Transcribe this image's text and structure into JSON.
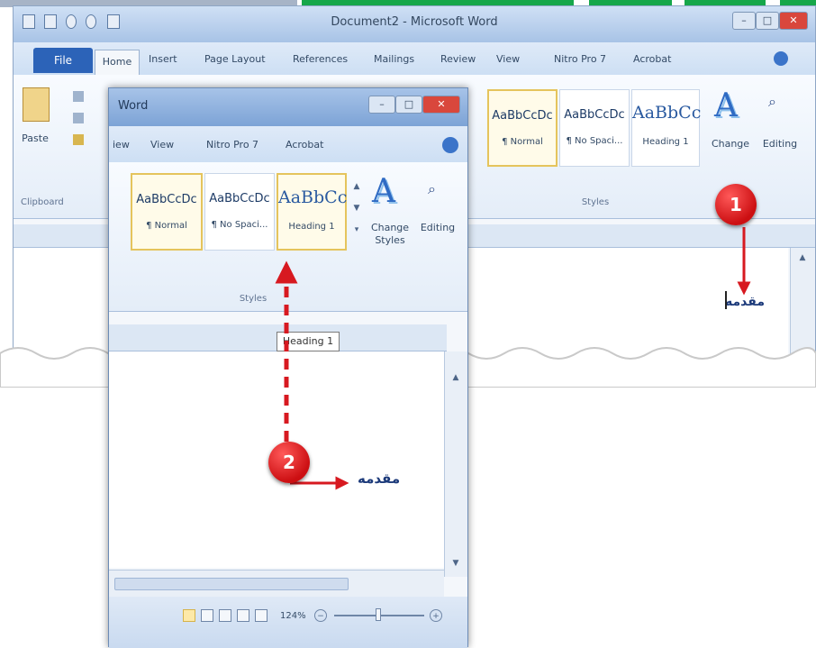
{
  "background_window": {
    "title": "Document2 - Microsoft Word",
    "tabs": [
      {
        "label": "File"
      },
      {
        "label": "Home"
      },
      {
        "label": "Insert"
      },
      {
        "label": "Page Layout"
      },
      {
        "label": "References"
      },
      {
        "label": "Mailings"
      },
      {
        "label": "Review"
      },
      {
        "label": "View"
      },
      {
        "label": "Nitro Pro 7"
      },
      {
        "label": "Acrobat"
      }
    ],
    "clipboard": {
      "paste_label": "Paste",
      "group_label": "Clipboard"
    },
    "styles": [
      {
        "sample": "AaBbCcDc",
        "name": "¶ Normal"
      },
      {
        "sample": "AaBbCcDc",
        "name": "¶ No Spaci..."
      },
      {
        "sample": "AaBbCc",
        "name": "Heading 1"
      }
    ],
    "styles_group_label": "Styles",
    "change_styles_label": "Change",
    "editing_label": "Editing",
    "document_text": "مقدمه"
  },
  "front_window": {
    "title": "Word",
    "tabs": [
      {
        "label": "iew"
      },
      {
        "label": "View"
      },
      {
        "label": "Nitro Pro 7"
      },
      {
        "label": "Acrobat"
      }
    ],
    "styles": [
      {
        "sample": "AaBbCcDc",
        "name": "¶ Normal"
      },
      {
        "sample": "AaBbCcDc",
        "name": "¶ No Spaci..."
      },
      {
        "sample": "AaBbCc",
        "name": "Heading 1"
      }
    ],
    "styles_group_label": "Styles",
    "change_styles_label": "Change Styles",
    "editing_label": "Editing",
    "tooltip": "Heading 1",
    "document_text": "مقدمه",
    "zoom_level": "124%"
  },
  "callouts": [
    {
      "number": "1"
    },
    {
      "number": "2"
    }
  ],
  "colors": {
    "callout_red": "#d71920",
    "file_tab_blue": "#2c63b8",
    "top_stripe_green": "#16a74a"
  }
}
